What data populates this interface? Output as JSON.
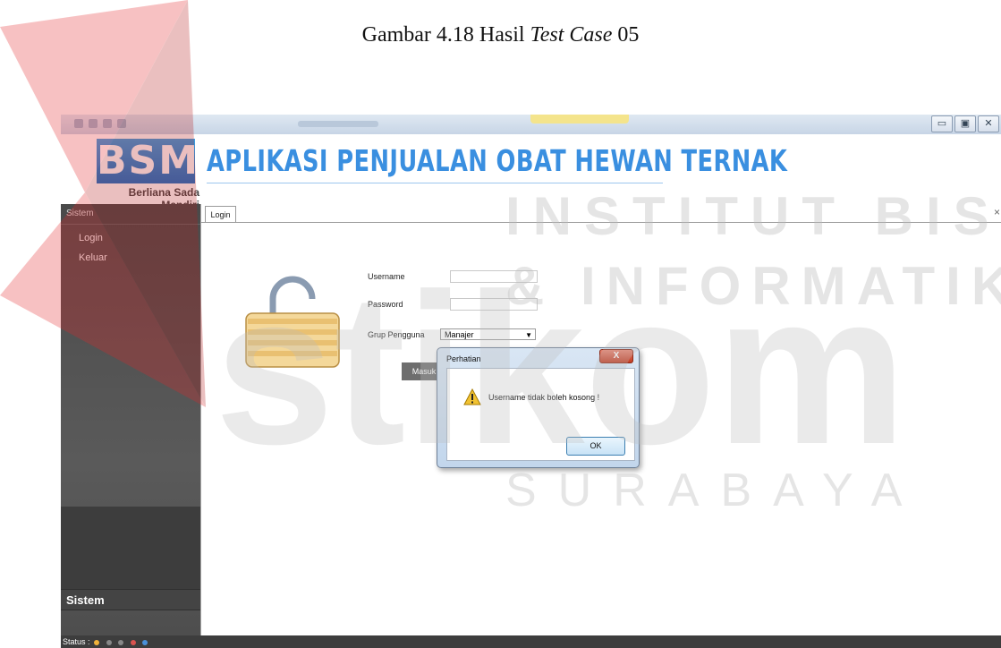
{
  "caption": {
    "prefix": "Gambar 4.18 Hasil ",
    "emphasis": "Test Case",
    "suffix": " 05"
  },
  "window": {
    "controls": [
      "minimize",
      "maximize",
      "close"
    ]
  },
  "header": {
    "logo_text": "BSM",
    "logo_subtitle": "Berliana Sada Mandiri",
    "app_title": "APLIKASI PENJUALAN OBAT HEWAN TERNAK"
  },
  "sidebar": {
    "header": "Sistem",
    "items": [
      {
        "label": "Login"
      },
      {
        "label": "Keluar"
      }
    ],
    "bottom_label": "Sistem"
  },
  "tabs": [
    {
      "label": "Login"
    }
  ],
  "form": {
    "username_label": "Username",
    "username_value": "",
    "password_label": "Password",
    "password_value": "",
    "group_label": "Grup Pengguna",
    "group_selected": "Manajer",
    "submit_label": "Masuk"
  },
  "dialog": {
    "title": "Perhatian",
    "message": "Username tidak boleh kosong !",
    "ok_label": "OK",
    "close_label": "X"
  },
  "status": {
    "label": "Status :"
  },
  "watermark": {
    "line1": "INSTITUT BISNIS",
    "line2": "& INFORMATIKA",
    "brand": "stikom",
    "city": "SURABAYA"
  },
  "colors": {
    "title_blue": "#3a8fe0",
    "sidebar_dark": "#4a4a4a",
    "statusbar": "#3d3d3d",
    "dialog_frame": "#c2d6ec",
    "watermark_red": "#e52528"
  }
}
